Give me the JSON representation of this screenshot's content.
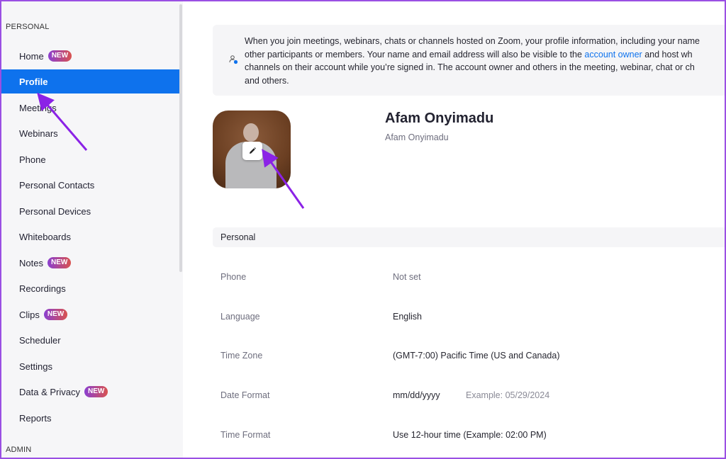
{
  "sidebar": {
    "personal_label": "PERSONAL",
    "admin_label": "ADMIN",
    "items": [
      {
        "label": "Home",
        "badge": "NEW"
      },
      {
        "label": "Profile",
        "badge": ""
      },
      {
        "label": "Meetings",
        "badge": ""
      },
      {
        "label": "Webinars",
        "badge": ""
      },
      {
        "label": "Phone",
        "badge": ""
      },
      {
        "label": "Personal Contacts",
        "badge": ""
      },
      {
        "label": "Personal Devices",
        "badge": ""
      },
      {
        "label": "Whiteboards",
        "badge": ""
      },
      {
        "label": "Notes",
        "badge": "NEW"
      },
      {
        "label": "Recordings",
        "badge": ""
      },
      {
        "label": "Clips",
        "badge": "NEW"
      },
      {
        "label": "Scheduler",
        "badge": ""
      },
      {
        "label": "Settings",
        "badge": ""
      },
      {
        "label": "Data & Privacy",
        "badge": "NEW"
      },
      {
        "label": "Reports",
        "badge": ""
      }
    ],
    "active_item": "Profile"
  },
  "notice": {
    "line1": "When you join meetings, webinars, chats or channels hosted on Zoom, your profile information, including your name",
    "line2_before": "other participants or members. Your name and email address will also be visible to the ",
    "line2_link": "account owner",
    "line2_after": " and host wh",
    "line3": "channels on their account while you’re signed in. The account owner and others in the meeting, webinar, chat or ch",
    "line4": "and others."
  },
  "profile": {
    "display_name": "Afam Onyimadu",
    "sub_name": "Afam Onyimadu"
  },
  "personal": {
    "section_title": "Personal",
    "rows": [
      {
        "label": "Phone",
        "value": "Not set",
        "example": ""
      },
      {
        "label": "Language",
        "value": "English",
        "example": ""
      },
      {
        "label": "Time Zone",
        "value": "(GMT-7:00) Pacific Time (US and Canada)",
        "example": ""
      },
      {
        "label": "Date Format",
        "value": "mm/dd/yyyy",
        "example": "Example: 05/29/2024"
      },
      {
        "label": "Time Format",
        "value": "Use 12-hour time (Example: 02:00 PM)",
        "example": ""
      }
    ]
  },
  "colors": {
    "accent": "#0e72ed",
    "annotation_arrow": "#8b22e6",
    "frame": "#9a4fe3"
  },
  "icons": {
    "edit": "pencil-icon",
    "notice": "user-privacy-icon"
  }
}
